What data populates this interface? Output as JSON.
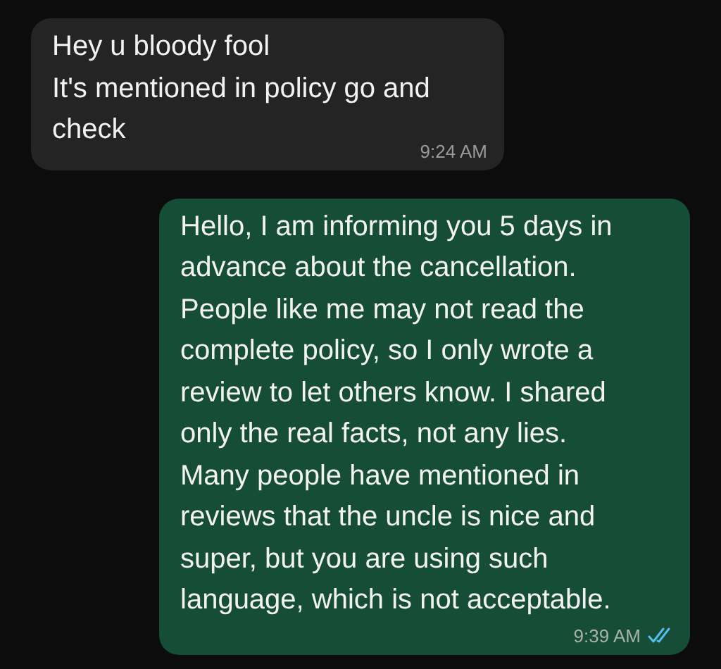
{
  "messages": [
    {
      "kind": "incoming",
      "lines": [
        "Hey u bloody fool",
        "It's mentioned in policy go and",
        "check"
      ],
      "time": "9:24 AM"
    },
    {
      "kind": "outgoing",
      "lines": [
        "Hello, I am informing you 5 days in",
        "advance about the cancellation.",
        "People like me may not read the",
        "complete policy, so I only wrote a",
        "review to let others know. I shared",
        "only the real facts, not any lies.",
        "Many people have mentioned in",
        "reviews that the uncle is nice and",
        "super, but you are using such",
        "language, which is not acceptable."
      ],
      "time": "9:39 AM",
      "read": true
    }
  ]
}
